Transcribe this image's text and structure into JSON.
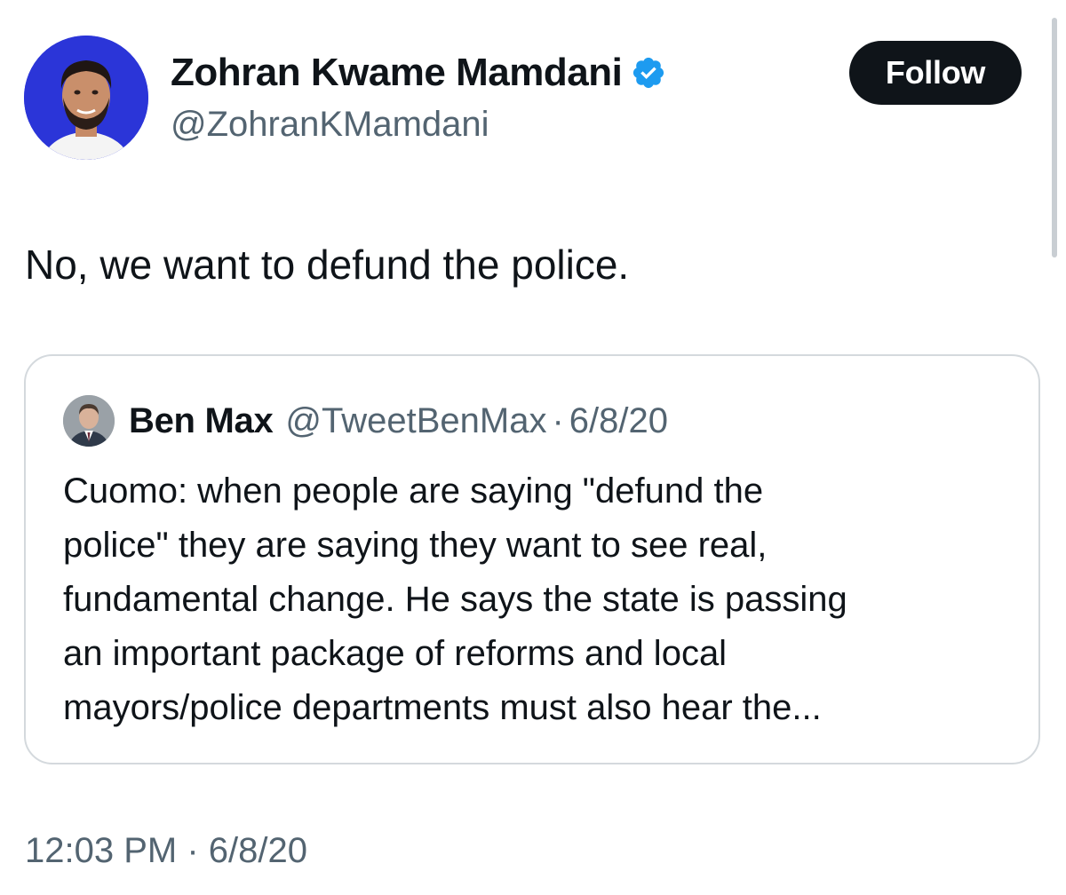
{
  "author": {
    "display_name": "Zohran Kwame Mamdani",
    "handle": "@ZohranKMamdani",
    "verified_icon": "verified-badge-icon",
    "avatar_bg": "#2b35d8"
  },
  "follow_button": {
    "label": "Follow"
  },
  "tweet": {
    "text": "No, we want to defund the police.",
    "time": "12:03 PM",
    "separator": "·",
    "date": "6/8/20"
  },
  "quoted_tweet": {
    "display_name": "Ben Max",
    "handle": "@TweetBenMax",
    "separator": "·",
    "date": "6/8/20",
    "text_lines": [
      "Cuomo: when people are saying \"defund the",
      "police\" they are saying they want to see real,",
      "fundamental change. He says the state is passing",
      "an important package of reforms and local",
      "mayors/police departments must also hear the..."
    ]
  },
  "colors": {
    "primary_text": "#0f1419",
    "secondary_text": "#536471",
    "verified_blue": "#1d9bf0",
    "border": "#d4d9dd"
  }
}
